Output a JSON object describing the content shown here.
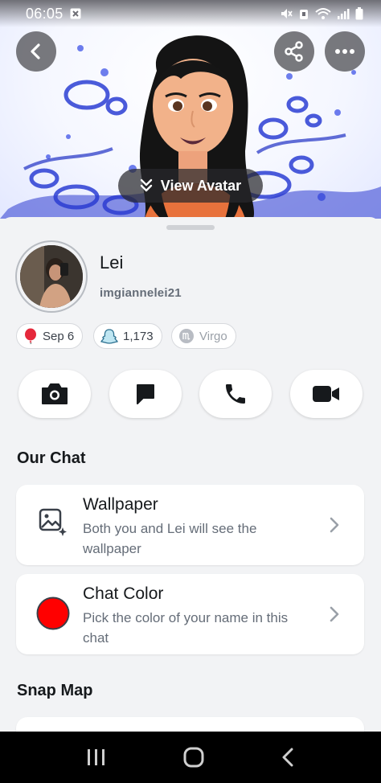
{
  "status_bar": {
    "time": "06:05",
    "icons": [
      "notification-x-icon",
      "mute-icon",
      "alarm-icon",
      "wifi-icon",
      "signal-icon",
      "battery-icon"
    ]
  },
  "header": {
    "back_icon": "chevron-left-icon",
    "share_icon": "share-icon",
    "more_icon": "more-icon",
    "view_avatar_label": "View Avatar"
  },
  "profile": {
    "display_name": "Lei",
    "username": "imgiannelei21",
    "chips": {
      "birthday": "Sep 6",
      "score": "1,173",
      "zodiac": "Virgo"
    }
  },
  "actions": [
    "camera-icon",
    "chat-icon",
    "phone-icon",
    "video-icon"
  ],
  "our_chat": {
    "title": "Our Chat",
    "wallpaper": {
      "title": "Wallpaper",
      "description": "Both you and Lei will see the wallpaper"
    },
    "chat_color": {
      "title": "Chat Color",
      "description": "Pick the color of your name in this chat",
      "color": "#ff0000"
    }
  },
  "snap_map": {
    "title": "Snap Map"
  },
  "nav_bar": {
    "icons": [
      "recents-icon",
      "home-icon",
      "back-icon"
    ]
  }
}
